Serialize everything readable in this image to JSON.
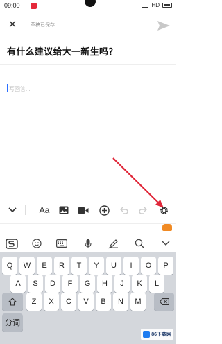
{
  "status_bar": {
    "time": "09:00",
    "right_text": "HD"
  },
  "topbar": {
    "close_label": "✕",
    "draft_status": "草稿已保存"
  },
  "question": {
    "title": "有什么建议给大一新生吗？"
  },
  "editor": {
    "placeholder": "写回答..."
  },
  "toolbar": {
    "font_label": "Aa"
  },
  "keyboard": {
    "row1": [
      "Q",
      "W",
      "E",
      "R",
      "T",
      "Y",
      "U",
      "I",
      "O",
      "P"
    ],
    "row2": [
      "A",
      "S",
      "D",
      "F",
      "G",
      "H",
      "J",
      "K",
      "L"
    ],
    "row3": [
      "Z",
      "X",
      "C",
      "V",
      "B",
      "N",
      "M"
    ],
    "fn_label": "分词"
  },
  "watermark": {
    "text": "86下载网"
  },
  "colors": {
    "accent": "#2b6fff",
    "annotation": "#e0283a",
    "mascot": "#f08a24"
  }
}
